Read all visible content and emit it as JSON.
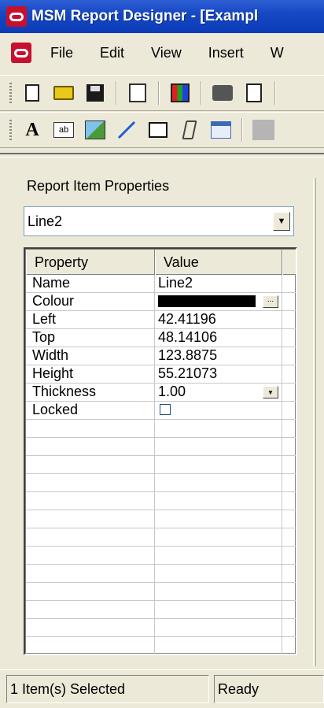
{
  "window": {
    "title": "MSM Report Designer - [Exampl",
    "icon": "oracle-logo-icon"
  },
  "menubar": {
    "items": [
      "File",
      "Edit",
      "View",
      "Insert",
      "W"
    ]
  },
  "toolbar_standard": {
    "buttons": [
      "new-document-icon",
      "open-folder-icon",
      "save-icon",
      "properties-icon",
      "colors-icon",
      "print-icon",
      "print-preview-icon"
    ]
  },
  "toolbar_items": {
    "buttons": [
      "text-icon",
      "textbox-icon",
      "image-icon",
      "line-icon",
      "rectangle-icon",
      "pencil-icon",
      "table-icon",
      "box-3d-icon"
    ],
    "text_icon_glyph": "A",
    "textbox_icon_glyph": "ab"
  },
  "panel": {
    "label": "Report Item Properties",
    "selected_item": "Line2"
  },
  "grid": {
    "headers": {
      "property": "Property",
      "value": "Value"
    },
    "rows": [
      {
        "name": "Name",
        "value": "Line2"
      },
      {
        "name": "Colour",
        "value": "",
        "swatch": "#000000",
        "button": "..."
      },
      {
        "name": "Left",
        "value": "42.41196"
      },
      {
        "name": "Top",
        "value": "48.14106"
      },
      {
        "name": "Width",
        "value": "123.8875"
      },
      {
        "name": "Height",
        "value": "55.21073"
      },
      {
        "name": "Thickness",
        "value": "1.00"
      },
      {
        "name": "Locked",
        "value": "",
        "checked": false
      }
    ]
  },
  "statusbar": {
    "selection": "1 Item(s) Selected",
    "state": "Ready"
  }
}
